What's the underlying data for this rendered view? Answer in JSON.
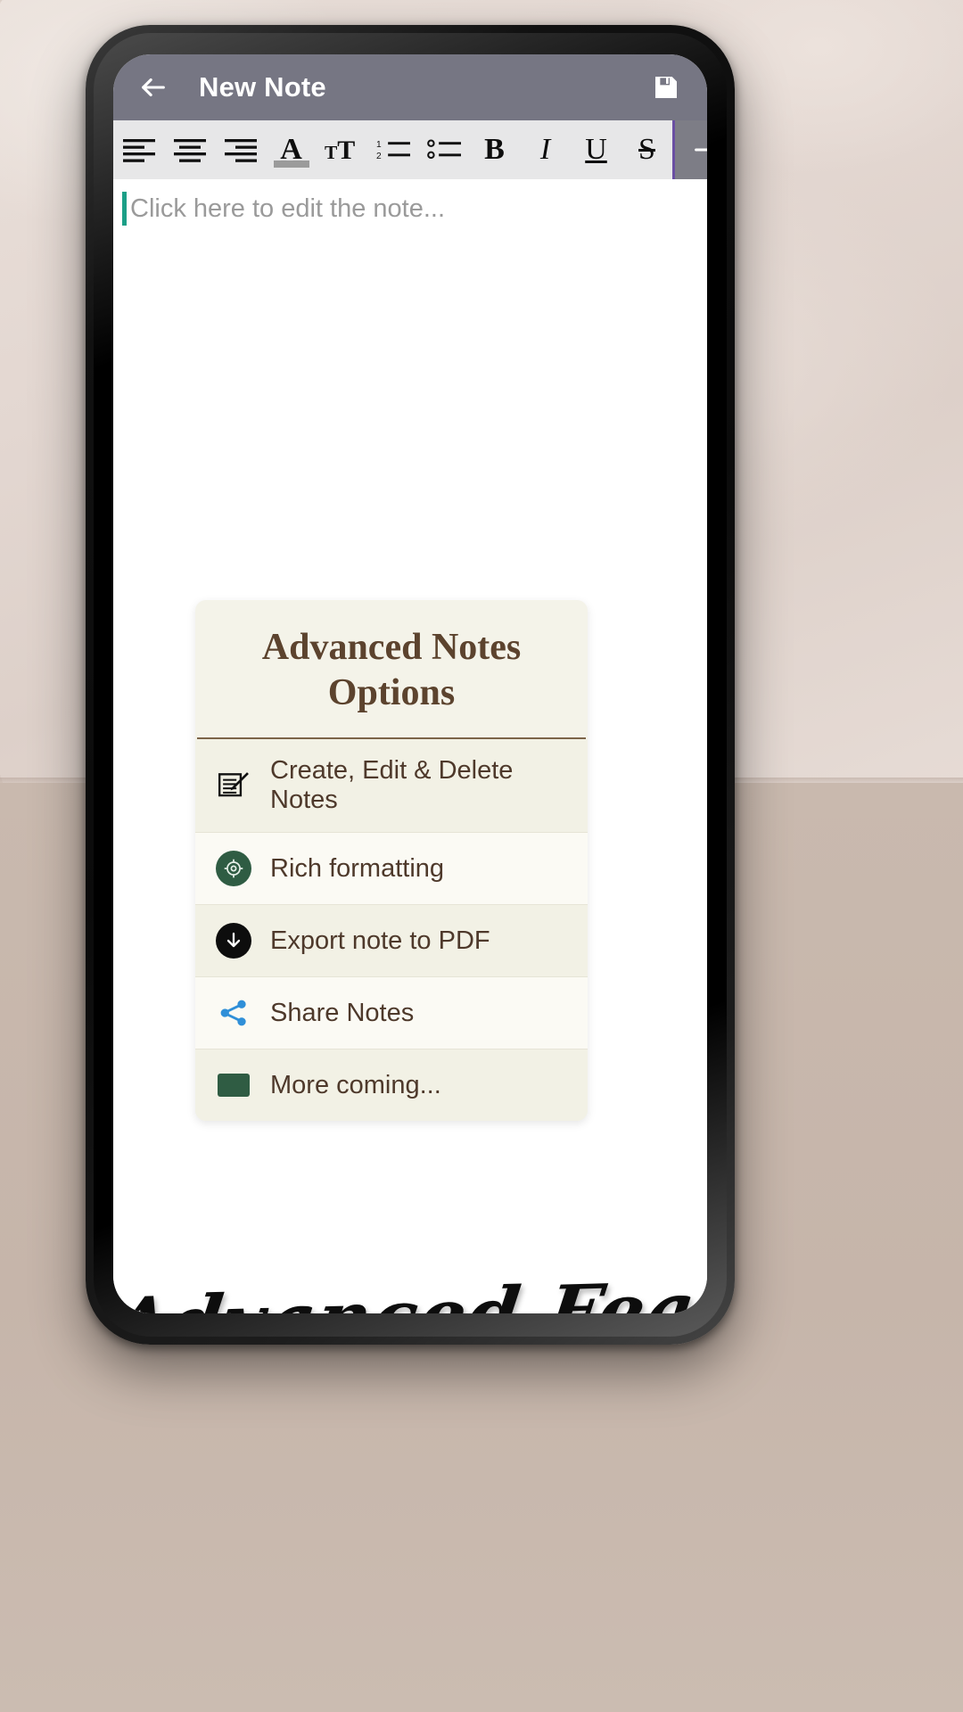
{
  "app": {
    "bar": {
      "back_icon": "arrow-left-icon",
      "title": "New Note",
      "save_icon": "save-floppy-icon"
    },
    "toolbar": {
      "items": [
        {
          "name": "align-left",
          "label": "",
          "icon": "align-left-icon"
        },
        {
          "name": "align-center",
          "label": "",
          "icon": "align-center-icon"
        },
        {
          "name": "align-right",
          "label": "",
          "icon": "align-right-icon"
        },
        {
          "name": "text-color",
          "label": "A",
          "icon": "text-color-icon"
        },
        {
          "name": "font-size",
          "label": "",
          "icon": "font-size-icon"
        },
        {
          "name": "numbered-list",
          "label": "",
          "icon": "numbered-list-icon"
        },
        {
          "name": "bulleted-list",
          "label": "",
          "icon": "bulleted-list-icon"
        },
        {
          "name": "bold",
          "label": "B",
          "icon": "bold-icon"
        },
        {
          "name": "italic",
          "label": "I",
          "icon": "italic-icon"
        },
        {
          "name": "underline",
          "label": "U",
          "icon": "underline-icon"
        },
        {
          "name": "strikethrough",
          "label": "S",
          "icon": "strikethrough-icon"
        }
      ],
      "more_icon": "arrow-right-icon",
      "accent_color": "#6a4fa3",
      "background": "#e7e7e8"
    },
    "editor": {
      "placeholder": "Click here to edit the note...",
      "caret_color": "#1b9f87"
    }
  },
  "dialog": {
    "title": "Advanced Notes Options",
    "title_color": "#5c432e",
    "background": "#f4f3e9",
    "rows": [
      {
        "label": "Create, Edit & Delete Notes",
        "icon": "note-edit-icon",
        "shade": "shade"
      },
      {
        "label": "Rich formatting",
        "icon": "target-circle-icon",
        "shade": "plain"
      },
      {
        "label": "Export note to PDF",
        "icon": "download-circle-icon",
        "shade": "shade"
      },
      {
        "label": "Share Notes",
        "icon": "share-icon",
        "shade": "plain"
      },
      {
        "label": "More coming...",
        "icon": "green-square-icon",
        "shade": "shade"
      }
    ]
  },
  "caption": {
    "text": "Advanced Features"
  },
  "colors": {
    "appbar": "#767683",
    "accent_green": "#2f5c43",
    "accent_blue": "#2f8fd8",
    "brown": "#5c432e"
  }
}
